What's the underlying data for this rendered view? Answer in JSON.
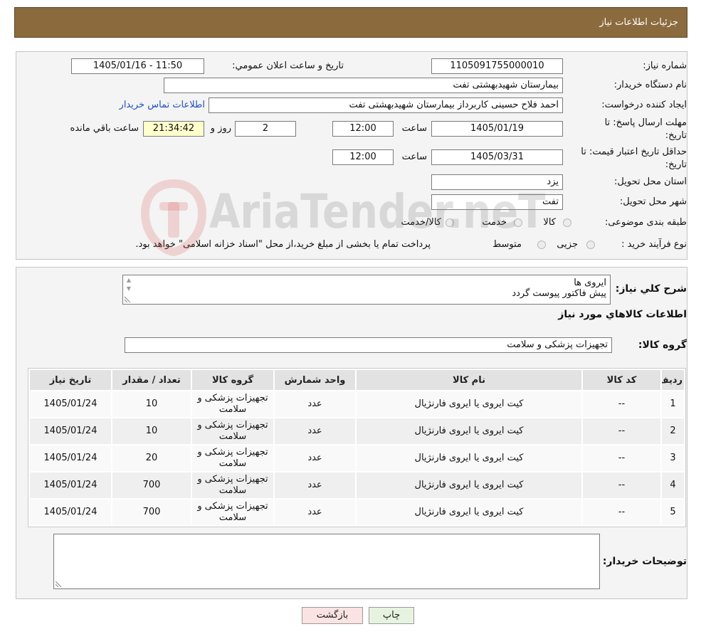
{
  "header": {
    "title": "جزئیات اطلاعات نیاز"
  },
  "theme": {
    "header_bg": "#8b6b3e",
    "link_color": "#1f4fc2",
    "timer_bg": "#ffffcc",
    "print_button_bg": "#e6f4df",
    "back_button_bg": "#fbe3e3"
  },
  "watermark": {
    "text": "AriaTender.neT"
  },
  "form": {
    "need_number": {
      "label": "شماره نیاز:",
      "value": "1105091755000010"
    },
    "announce_datetime": {
      "label": "تاریخ و ساعت اعلان عمومي:",
      "value": "1405/01/16 - 11:50"
    },
    "buyer_org": {
      "label": "نام دستگاه خریدار:",
      "value": "بیمارستان شهیدبهشتی تفت"
    },
    "requester": {
      "label": "ایجاد کننده درخواست:",
      "value": "احمد فلاح حسینی کاربرداز بیمارستان شهیدبهشتی تفت",
      "contact_link": "اطلاعات تماس خریدار"
    },
    "response_deadline": {
      "label_line1": "مهلت ارسال پاسخ: تا",
      "label_line2": "تاریخ:",
      "date": "1405/01/19",
      "time_label": "ساعت",
      "time": "12:00",
      "days": "2",
      "days_label": "روز و",
      "remaining_time": "21:34:42",
      "remaining_label": "ساعت باقي مانده"
    },
    "price_validity": {
      "label_line1": "حداقل تاریخ اعتبار قیمت: تا",
      "label_line2": "تاریخ:",
      "date": "1405/03/31",
      "time_label": "ساعت",
      "time": "12:00"
    },
    "delivery_province": {
      "label": "استان محل تحویل:",
      "value": "یزد"
    },
    "delivery_city": {
      "label": "شهر محل تحویل:",
      "value": "تفت"
    },
    "subject_category": {
      "label": "طبقه بندی موضوعی:",
      "options": [
        "کالا",
        "خدمت",
        "کالا/خدمت"
      ]
    },
    "purchase_process": {
      "label": "نوع فرآیند خرید :",
      "options": [
        "جزیی",
        "متوسط"
      ],
      "treasury_note": "پرداخت تمام یا بخشی از مبلغ خرید،از محل \"اسناد خزانه اسلامی\" خواهد بود."
    }
  },
  "description": {
    "label": "شرح کلي نیاز:",
    "lines": [
      "ایروی ها",
      "پیش فاکتور پیوست گردد"
    ]
  },
  "items_section": {
    "title": "اطلاعات کالاهاي مورد نیاز",
    "group_label": "گروه کالا:",
    "group_value": "تجهیزات پزشکی و سلامت"
  },
  "items_table": {
    "columns": [
      "ردیف",
      "کد کالا",
      "نام کالا",
      "واحد شمارش",
      "گروه کالا",
      "تعداد / مقدار",
      "تاریخ نیاز"
    ],
    "rows": [
      [
        "1",
        "--",
        "کیت ایروی یا ایروی فارنژیال",
        "عدد",
        "تجهیزات پزشکی و سلامت",
        "10",
        "1405/01/24"
      ],
      [
        "2",
        "--",
        "کیت ایروی یا ایروی فارنژیال",
        "عدد",
        "تجهیزات پزشکی و سلامت",
        "10",
        "1405/01/24"
      ],
      [
        "3",
        "--",
        "کیت ایروی یا ایروی فارنژیال",
        "عدد",
        "تجهیزات پزشکی و سلامت",
        "20",
        "1405/01/24"
      ],
      [
        "4",
        "--",
        "کیت ایروی یا ایروی فارنژیال",
        "عدد",
        "تجهیزات پزشکی و سلامت",
        "700",
        "1405/01/24"
      ],
      [
        "5",
        "--",
        "کیت ایروی یا ایروی فارنژیال",
        "عدد",
        "تجهیزات پزشکی و سلامت",
        "700",
        "1405/01/24"
      ]
    ]
  },
  "buyer_notes": {
    "label": "توضیحات خریدار:"
  },
  "buttons": {
    "print": "چاپ",
    "back": "بازگشت"
  }
}
